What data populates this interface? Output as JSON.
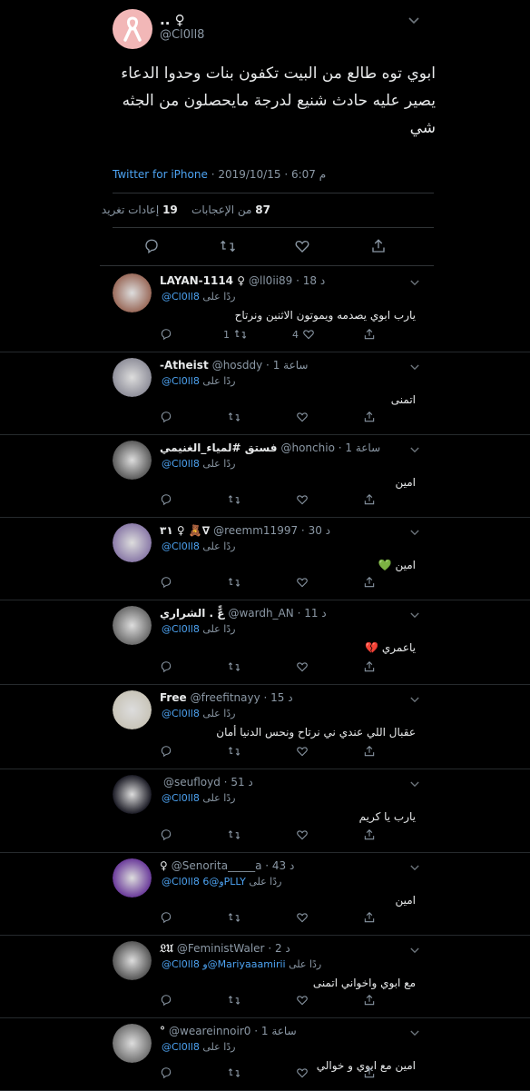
{
  "main_tweet": {
    "name": ".. ♀",
    "handle": "@Cl0ll8",
    "text": "ابوي توه طالع من البيت تكفون بنات وحدوا الدعاء يصير عليه حادث شنيع لدرجة مايحصلون من الجثه شي",
    "source": "Twitter for iPhone",
    "date": "2019/10/15",
    "time": "6:07 م",
    "retweets": "19",
    "retweets_label": "إعادات تغريد",
    "likes": "87",
    "likes_label": "من الإعجابات"
  },
  "replies": [
    {
      "name": "LAYAN-1114 ♀",
      "handle": "@ll0ii89",
      "time": "18 د",
      "reply_to_label": "ردًا على",
      "reply_to": "@Cl0ll8",
      "text": "يارب ابوي يصدمه ويموتون الاثنين ونرتاح",
      "retweets": "1",
      "likes": "4",
      "avatar_color": "#9a6a5a"
    },
    {
      "name": "-Atheist",
      "handle": "@hosddy",
      "time": "1 ساعة",
      "reply_to_label": "ردًا على",
      "reply_to": "@Cl0ll8",
      "text": "اتمنى",
      "retweets": "",
      "likes": "",
      "avatar_color": "#8f8f9a"
    },
    {
      "name": "فستق #لمياء_الغنيمي",
      "handle": "@honchio",
      "time": "1 ساعة",
      "reply_to_label": "ردًا على",
      "reply_to": "@Cl0ll8",
      "text": "امين",
      "retweets": "",
      "likes": "",
      "avatar_color": "#5a5a5a"
    },
    {
      "name": "٣١ ♀ 🧸∇",
      "handle": "@reemm11997",
      "time": "30 د",
      "reply_to_label": "ردًا على",
      "reply_to": "@Cl0ll8",
      "text": "امين 💚",
      "retweets": "",
      "likes": "",
      "avatar_color": "#8a7aa8"
    },
    {
      "name": "عًّ . الشراري",
      "handle": "@wardh_AN",
      "time": "11 د",
      "reply_to_label": "ردًا على",
      "reply_to": "@Cl0ll8",
      "text": "ياعمري 💔",
      "retweets": "",
      "likes": "",
      "avatar_color": "#6a6a6a"
    },
    {
      "name": "Free",
      "handle": "@freefitnayy",
      "time": "15 د",
      "reply_to_label": "ردًا على",
      "reply_to": "@Cl0ll8",
      "text": "عقبال اللي عندي ني نرتاح ونحس الدنيا أمان",
      "retweets": "",
      "likes": "",
      "avatar_color": "#c8c4b8"
    },
    {
      "name": "",
      "handle": "@seufloyd",
      "time": "51 د",
      "reply_to_label": "ردًا على",
      "reply_to": "@Cl0ll8",
      "text": "يارب يا كريم",
      "retweets": "",
      "likes": "",
      "avatar_color": "#1a1a24"
    },
    {
      "name": "♀",
      "handle": "@Senorita_____a",
      "time": "43 د",
      "reply_to_label": "ردًا على",
      "reply_to": "@Cl0ll8 و@6PLLY",
      "text": "امين",
      "retweets": "",
      "likes": "",
      "avatar_color": "#6a3a9a"
    },
    {
      "name": "𝔏𝔘",
      "handle": "@FeministWaler",
      "time": "2 د",
      "reply_to_label": "ردًا على",
      "reply_to": "@Cl0ll8 و@Mariyaaamirii",
      "text": "مع ابوي واخواني اتمنى",
      "retweets": "",
      "likes": "",
      "avatar_color": "#555555"
    },
    {
      "name": "°",
      "handle": "@weareinnoir0",
      "time": "1 ساعة",
      "reply_to_label": "ردًا على",
      "reply_to": "@Cl0ll8",
      "text": "امين مع ابوي و خوالي",
      "retweets": "",
      "likes": "",
      "avatar_color": "#707070"
    }
  ]
}
